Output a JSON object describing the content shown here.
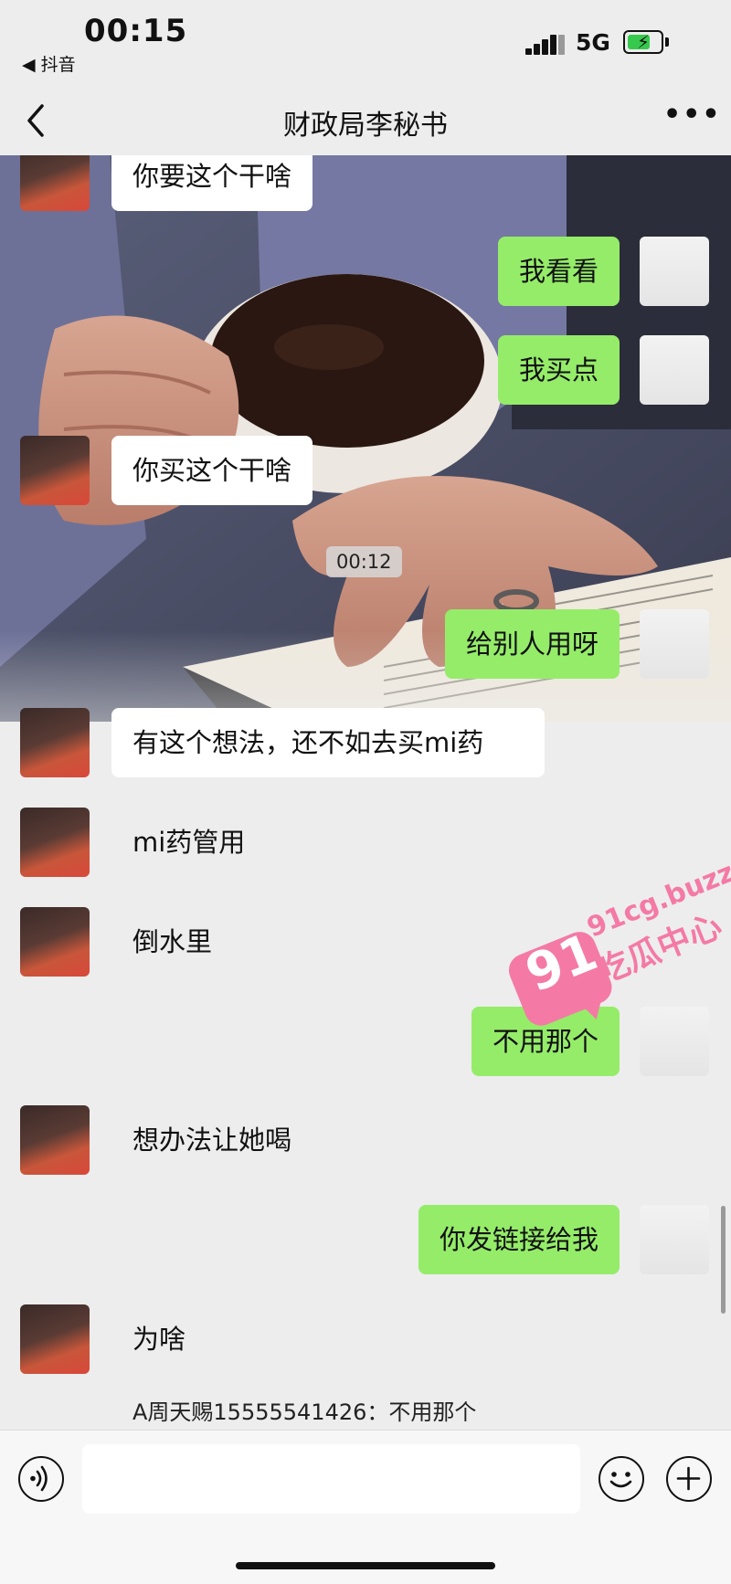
{
  "status_bar": {
    "time": "00:15",
    "back_to_app": "◀ 抖音",
    "network": "5G",
    "battery_icon": "battery-charging-icon"
  },
  "navbar": {
    "title": "财政局李秘书",
    "back_icon": "chevron-left-icon",
    "more_icon": "more-dots-icon",
    "more_label": "•••"
  },
  "chat": {
    "background_photo": "coffee-cup-and-book-photo",
    "time_divider": "00:12",
    "messages": [
      {
        "from": "her",
        "text": "你要这个干啥"
      },
      {
        "from": "me",
        "text": "我看看"
      },
      {
        "from": "me",
        "text": "我买点"
      },
      {
        "from": "her",
        "text": "你买这个干啥"
      },
      {
        "from": "me",
        "text": "给别人用呀"
      },
      {
        "from": "her",
        "text": "有这个想法，还不如去买mi药"
      },
      {
        "from": "her",
        "text": "mi药管用"
      },
      {
        "from": "her",
        "text": "倒水里"
      },
      {
        "from": "me",
        "text": "不用那个"
      },
      {
        "from": "her",
        "text": "想办法让她喝"
      },
      {
        "from": "me",
        "text": "你发链接给我"
      },
      {
        "from": "her",
        "text": "为啥"
      }
    ],
    "quote": "A周天赐15555541426：不用那个"
  },
  "watermark": {
    "number": "91",
    "domain": "91cg.buzz",
    "name": "吃瓜中心"
  },
  "input_bar": {
    "voice_icon": "voice-icon",
    "emoji_icon": "emoji-icon",
    "plus_icon": "plus-icon",
    "input_value": ""
  },
  "colors": {
    "background": "#ededed",
    "bubble_out": "#95ec69",
    "bubble_in": "#ffffff",
    "watermark": "#f47aa5"
  }
}
